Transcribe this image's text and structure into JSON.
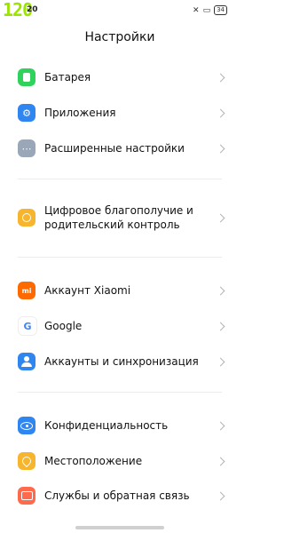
{
  "status": {
    "watermark": "120",
    "time": "20",
    "battery": "34"
  },
  "title": "Настройки",
  "items": [
    {
      "label": "Батарея",
      "icon": "battery-icon",
      "color": "#2fd35c",
      "glyph": "▮"
    },
    {
      "label": "Приложения",
      "icon": "gear-icon",
      "color": "#2f86f0",
      "glyph": "⚙"
    },
    {
      "label": "Расширенные настройки",
      "icon": "more-icon",
      "color": "#9aa7b8",
      "glyph": "⋯"
    },
    {
      "label": "Цифровое благополучие и родительский контроль",
      "icon": "family-icon",
      "color": "#f6b52d",
      "glyph": "☺"
    },
    {
      "label": "Аккаунт Xiaomi",
      "icon": "xiaomi-icon",
      "color": "#ff6a00",
      "glyph": "mi"
    },
    {
      "label": "Google",
      "icon": "google-icon",
      "color": "#ffffff",
      "glyph": "G"
    },
    {
      "label": "Аккаунты и синхронизация",
      "icon": "account-icon",
      "color": "#2f86f0",
      "glyph": "👤"
    },
    {
      "label": "Конфиденциальность",
      "icon": "eye-icon",
      "color": "#2f86f0",
      "glyph": "◉"
    },
    {
      "label": "Местоположение",
      "icon": "location-icon",
      "color": "#f6b52d",
      "glyph": "⌾"
    },
    {
      "label": "Службы и обратная связь",
      "icon": "feedback-icon",
      "color": "#ff6a4d",
      "glyph": "▭"
    }
  ]
}
